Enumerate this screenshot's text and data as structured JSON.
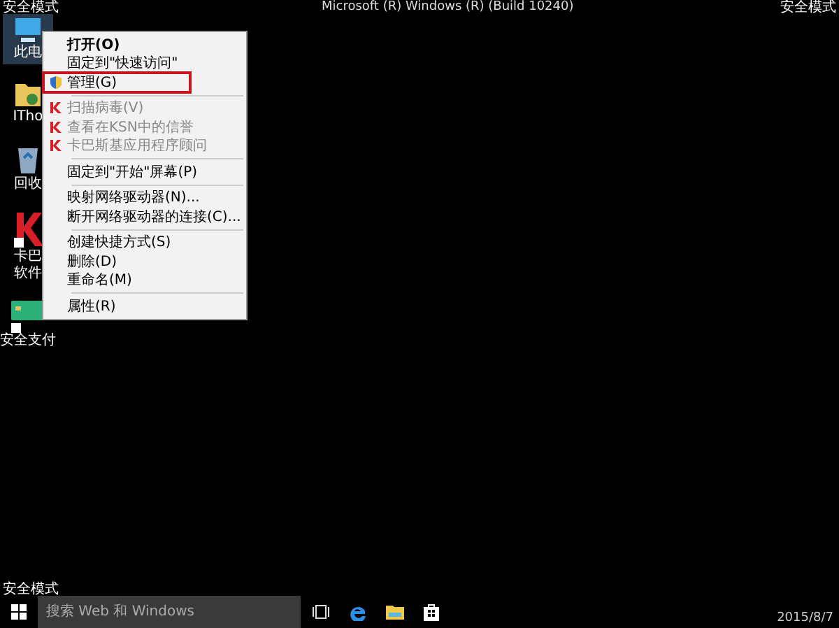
{
  "top_bar": {
    "left": "安全模式",
    "title": "Microsoft (R) Windows (R) (Build 10240)",
    "right": "安全模式"
  },
  "desktop_icons": [
    {
      "kind": "computer",
      "label": "此电",
      "selected": true
    },
    {
      "kind": "folder",
      "label": "ITho",
      "selected": false
    },
    {
      "kind": "recycle",
      "label": "回收",
      "selected": false
    },
    {
      "kind": "kaspersky",
      "label": "卡巴",
      "label_2": "软件",
      "selected": false
    },
    {
      "kind": "card",
      "label": "安全支付",
      "selected": false
    }
  ],
  "context_menu": {
    "groups": [
      [
        {
          "kind": "plain",
          "label": "打开(O)",
          "bold": true,
          "highlighted": false,
          "disabled": false
        },
        {
          "kind": "plain",
          "label": "固定到\"快速访问\"",
          "bold": false,
          "highlighted": false,
          "disabled": false
        },
        {
          "kind": "shield",
          "label": "管理(G)",
          "bold": false,
          "highlighted": true,
          "disabled": false
        }
      ],
      [
        {
          "kind": "kaspersky",
          "label": "扫描病毒(V)",
          "bold": false,
          "highlighted": false,
          "disabled": true
        },
        {
          "kind": "kaspersky",
          "label": "查看在KSN中的信誉",
          "bold": false,
          "highlighted": false,
          "disabled": true
        },
        {
          "kind": "kaspersky",
          "label": "卡巴斯基应用程序顾问",
          "bold": false,
          "highlighted": false,
          "disabled": true
        }
      ],
      [
        {
          "kind": "plain",
          "label": "固定到\"开始\"屏幕(P)",
          "bold": false,
          "highlighted": false,
          "disabled": false
        }
      ],
      [
        {
          "kind": "plain",
          "label": "映射网络驱动器(N)...",
          "bold": false,
          "highlighted": false,
          "disabled": false
        },
        {
          "kind": "plain",
          "label": "断开网络驱动器的连接(C)...",
          "bold": false,
          "highlighted": false,
          "disabled": false
        }
      ],
      [
        {
          "kind": "plain",
          "label": "创建快捷方式(S)",
          "bold": false,
          "highlighted": false,
          "disabled": false
        },
        {
          "kind": "plain",
          "label": "删除(D)",
          "bold": false,
          "highlighted": false,
          "disabled": false
        },
        {
          "kind": "plain",
          "label": "重命名(M)",
          "bold": false,
          "highlighted": false,
          "disabled": false
        }
      ],
      [
        {
          "kind": "plain",
          "label": "属性(R)",
          "bold": false,
          "highlighted": false,
          "disabled": false
        }
      ]
    ]
  },
  "bottom_left": "安全模式",
  "taskbar": {
    "search": {
      "placeholder": "搜索 Web 和 Windows"
    },
    "date": "2015/8/7"
  }
}
